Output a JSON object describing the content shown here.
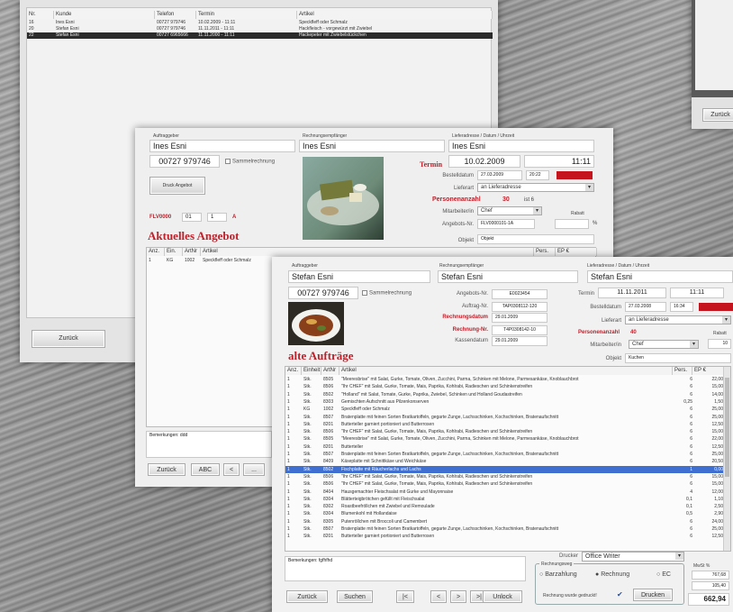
{
  "list_window": {
    "columns": [
      "Nr.",
      "Kunde",
      "Telefon",
      "Termin",
      "Artikel"
    ],
    "rows": [
      [
        "16",
        "Ines Esni",
        "00727 979746",
        "10.02.2009 - 11:11",
        "Speckfleff oder Schmalz"
      ],
      [
        "20",
        "Stefan Esni",
        "00727 979746",
        "11.11.2011 - 11:11",
        "Hackfleisch - vorgewürzt mit Zwiebel"
      ],
      [
        "22",
        "Stefan Esni",
        "00727 6965666",
        "11.11.2000 - 11:11",
        "Hackepeter mit Zwiebelstückchen"
      ]
    ],
    "back_button": "Zurück"
  },
  "corner_window": {
    "button": "Zurück"
  },
  "offer_window": {
    "lbl_client": "Auftraggeber",
    "lbl_billing": "Rechnungsempfänger",
    "lbl_delivery": "Lieferadresse / Datum / Uhrzeit",
    "client": "Ines Esni",
    "billing": "Ines Esni",
    "delivery": "Ines Esni",
    "phone": "00727 979746",
    "collective": "Sammelrechnung",
    "print_offer": "Druck Angebot",
    "offer_code": "FLV0000",
    "offer_code_n1": "01",
    "offer_code_n2": "1",
    "offer_code_suffix": "A",
    "termin_label": "Termin",
    "date": "10.02.2009",
    "time": "11:11",
    "order_date_label": "Bestelldatum",
    "order_date": "27.03.2009",
    "order_time": "20:22",
    "lieferart_label": "Lieferart",
    "lieferart": "an Lieferadresse",
    "persons_label": "Personenanzahl",
    "persons": "30",
    "persons_extra": "ist 6",
    "staff_label": "Mitarbeiter/in",
    "staff": "Chef",
    "offer_no_label": "Angebots-Nr.",
    "offer_no": "FLV0000101-1A",
    "discount_label": "Rabatt",
    "discount_unit": "%",
    "object_label": "Objekt",
    "object": "Objekt",
    "section_title": "Aktuelles Angebot",
    "columns": [
      "Anz.",
      "Ein.",
      "ArtNr",
      "Artikel",
      "Pers.",
      "EP €"
    ],
    "rows": [
      [
        "1",
        "KG",
        "1002",
        "Speckfleff oder Schmalz",
        "",
        ""
      ]
    ],
    "notes_label": "Bemerkungen: ddd",
    "nav": [
      "Zurück",
      "ABC",
      "<",
      "..."
    ]
  },
  "orders_window": {
    "lbl_client": "Auftraggeber",
    "lbl_billing": "Rechnungsempfänger",
    "lbl_delivery": "Lieferadresse / Datum / Uhrzeit",
    "client": "Stefan Esni",
    "billing": "Stefan Esni",
    "delivery": "Stefan Esni",
    "phone": "00727 979746",
    "collective": "Sammelrechnung",
    "offer_no_label": "Angebots-Nr.",
    "offer_no": "E0023454",
    "order_no_label": "Auftrag-Nr.",
    "order_no": "TAP0308112-120",
    "invoice_date_label": "Rechnungsdatum",
    "invoice_date": "29.01.2009",
    "invoice_no_label": "Rechnung-Nr.",
    "invoice_no": "T4P0308142-10",
    "cash_date_label": "Kassendatum",
    "cash_date": "29.01.2009",
    "termin_label": "Termin",
    "date": "11.11.2011",
    "time": "11:11",
    "order_date_label": "Bestelldatum",
    "order_date": "27.03.2008",
    "order_time": "16:34",
    "lieferart_label": "Lieferart",
    "lieferart": "an Lieferadresse",
    "persons_label": "Personenanzahl",
    "persons": "40",
    "staff_label": "Mitarbeiter/in",
    "staff": "Chef",
    "discount_label": "Rabatt",
    "discount": "10",
    "object_label": "Objekt",
    "object": "Kuchen",
    "section_title": "alte Aufträge",
    "columns": [
      "Anz.",
      "Einheit",
      "ArtNr",
      "Artikel",
      "Pers.",
      "EP €"
    ],
    "rows": [
      [
        "1",
        "Stk.",
        "8505",
        "\"Meeresbrise\" mit Salat, Gurke, Tomate, Oliven, Zucchini, Parma, Schinken mit Melone, Parmesankäse, Knoblauchbrot",
        "6",
        "22,00"
      ],
      [
        "1",
        "Stk.",
        "8506",
        "\"Ihr CHEF\" mit Salat, Gurke, Tomate, Mais, Paprika, Kohlrabi, Radieschen und Schinkenstreifen",
        "6",
        "15,00"
      ],
      [
        "1",
        "Stk.",
        "8502",
        "\"Holland\" mit Salat, Tomate, Gurke, Paprika, Zwiebel, Schinken und Holland Goudastreifen",
        "6",
        "14,00"
      ],
      [
        "1",
        "Stk.",
        "8303",
        "Gemischten Aufschnitt aus Pilzenkonserven",
        "0,25",
        "1,50"
      ],
      [
        "1",
        "KG",
        "1002",
        "Speckfleff oder Schmalz",
        "6",
        "25,00"
      ],
      [
        "1",
        "Stk.",
        "8507",
        "Bratenplatte mit feinen Sorten Bratkartoffeln, gegarte Zunge, Lachsschinken, Kochschinken, Bratenaufschnitt",
        "6",
        "25,00"
      ],
      [
        "1",
        "Stk.",
        "8201",
        "Butterteller garniert portioniert und Butterrosen",
        "6",
        "12,50"
      ],
      [
        "1",
        "Stk.",
        "8506",
        "\"Ihr CHEF\" mit Salat, Gurke, Tomate, Mais, Paprika, Kohlrabi, Radieschen und Schinkenstreifen",
        "6",
        "15,00"
      ],
      [
        "1",
        "Stk.",
        "8505",
        "\"Meeresbrise\" mit Salat, Gurke, Tomate, Oliven, Zucchini, Parma, Schinken mit Melone, Parmesankäse, Knoblauchbrot",
        "6",
        "22,00"
      ],
      [
        "1",
        "Stk.",
        "8201",
        "Butterteller",
        "6",
        "12,50"
      ],
      [
        "1",
        "Stk.",
        "8507",
        "Bratenplatte mit feinen Sorten Bratkartoffeln, gegarte Zunge, Lachsschinken, Kochschinken, Bratenaufschnitt",
        "6",
        "25,00"
      ],
      [
        "1",
        "Stk.",
        "8409",
        "Käseplatte mit Schnittkäse und Weichkäse",
        "6",
        "20,50"
      ],
      [
        "1",
        "Stk.",
        "8502",
        "Fischplatte mit Räucherlachs und Lachs",
        "1",
        "0,00"
      ],
      [
        "1",
        "Stk.",
        "8506",
        "\"Ihr CHEF\" mit Salat, Gurke, Tomate, Mais, Paprika, Kohlrabi, Radieschen und Schinkenstreifen",
        "6",
        "15,00"
      ],
      [
        "1",
        "Stk.",
        "8506",
        "\"Ihr CHEF\" mit Salat, Gurke, Tomate, Mais, Paprika, Kohlrabi, Radieschen und Schinkenstreifen",
        "6",
        "15,00"
      ],
      [
        "1",
        "Stk.",
        "8404",
        "Hausgemachter Fleischsalat mit Gurke und Mayonnaise",
        "4",
        "12,00"
      ],
      [
        "1",
        "Stk.",
        "8304",
        "Blätterteigbrötchen gefüllt mit Fleischsalat",
        "0,1",
        "1,10"
      ],
      [
        "1",
        "Stk.",
        "8302",
        "Roastbeefröllchen mit Zwiebel und Remoulade",
        "0,1",
        "2,50"
      ],
      [
        "1",
        "Stk.",
        "8304",
        "Blumenkohl mit Hollandaise",
        "0,5",
        "2,90"
      ],
      [
        "1",
        "Stk.",
        "8305",
        "Putenröllchen mit Broccoli und Camembert",
        "6",
        "24,00"
      ],
      [
        "1",
        "Stk.",
        "8507",
        "Bratenplatte mit feinen Sorten Bratkartoffeln, gegarte Zunge, Lachsschinken, Kochschinken, Bratenaufschnitt",
        "6",
        "25,00"
      ],
      [
        "1",
        "Stk.",
        "8201",
        "Butterteller garniert portioniert und Butterrosen",
        "6",
        "12,50"
      ]
    ],
    "selected_row": 12,
    "notes_label": "Bemerkungen: fgfhfhd",
    "printer_label": "Drucker",
    "printer": "Office Writer",
    "payment_title": "Rechnungsweg",
    "pay_options": [
      "Barzahlung",
      "Rechnung",
      "EC"
    ],
    "invoice_printed": "Rechnung wurde gedruckt!",
    "print_button": "Drucken",
    "vat_label": "MwSt %",
    "sum1": "767,68",
    "sum2": "105,40",
    "total": "662,94",
    "nav": [
      "Zurück",
      "Suchen",
      "|<",
      "<",
      ">",
      ">|",
      "Unlock"
    ]
  }
}
